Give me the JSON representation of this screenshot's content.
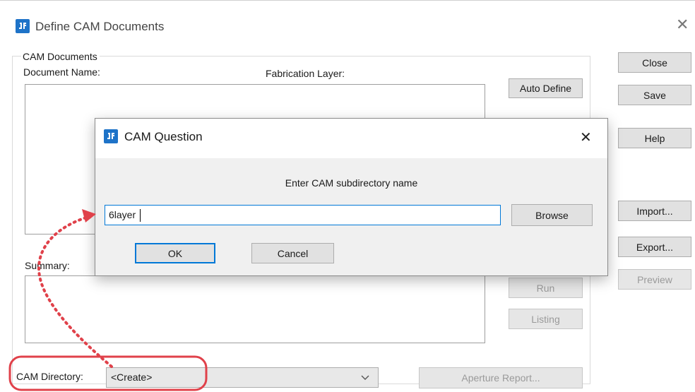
{
  "main_window": {
    "title": "Define CAM Documents",
    "group_label": "CAM Documents",
    "document_name_header": "Document Name:",
    "fabrication_layer_header": "Fabrication Layer:",
    "summary_label": "Summary:",
    "cam_directory_label": "CAM Directory:",
    "cam_directory_value": "<Create>",
    "buttons": {
      "close": "Close",
      "save": "Save",
      "help": "Help",
      "auto_define": "Auto Define",
      "import": "Import...",
      "export": "Export...",
      "preview": "Preview",
      "run": "Run",
      "listing": "Listing",
      "aperture_report": "Aperture Report..."
    }
  },
  "dialog": {
    "title": "CAM Question",
    "prompt": "Enter CAM subdirectory name",
    "input_value": "6layer",
    "buttons": {
      "browse": "Browse",
      "ok": "OK",
      "cancel": "Cancel"
    }
  },
  "colors": {
    "annotation": "#e0414a",
    "accent": "#0078d7",
    "app_icon": "#1e73c8"
  }
}
